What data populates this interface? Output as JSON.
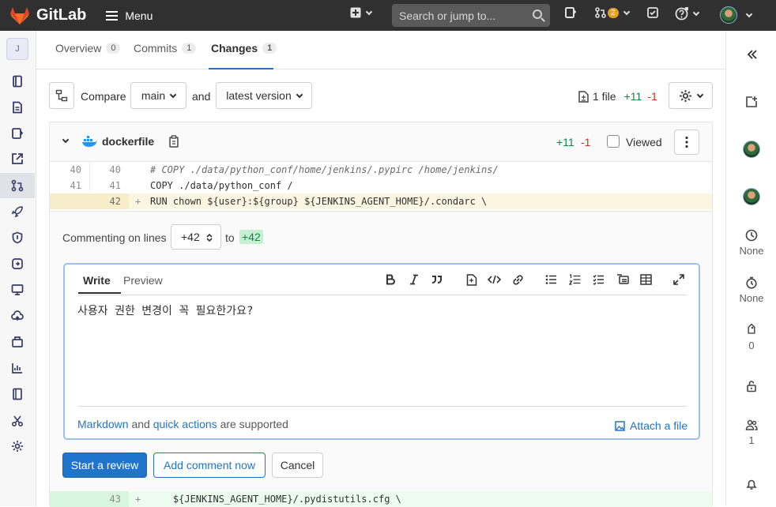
{
  "topbar": {
    "brand": "GitLab",
    "menu_label": "Menu",
    "search_placeholder": "Search or jump to...",
    "mr_count": "2"
  },
  "sidebar": {
    "project_letter": "J"
  },
  "tabs": [
    {
      "label": "Overview",
      "count": "0"
    },
    {
      "label": "Commits",
      "count": "1"
    },
    {
      "label": "Changes",
      "count": "1"
    }
  ],
  "compare": {
    "label": "Compare",
    "base": "main",
    "and_label": "and",
    "target": "latest version",
    "files_label": "1 file",
    "additions": "+11",
    "deletions": "-1"
  },
  "file": {
    "name": "dockerfile",
    "additions": "+11",
    "deletions": "-1",
    "viewed_label": "Viewed"
  },
  "diff_lines": [
    {
      "old": "40",
      "new": "40",
      "sign": "",
      "code": "# COPY ./data/python_conf/home/jenkins/.pypirc /home/jenkins/"
    },
    {
      "old": "41",
      "new": "41",
      "sign": "",
      "code": "COPY ./data/python_conf /"
    },
    {
      "old": "",
      "new": "42",
      "sign": "+",
      "code": "RUN chown ${user}:${group} ${JENKINS_AGENT_HOME}/.condarc \\"
    },
    {
      "old": "",
      "new": "43",
      "sign": "+",
      "code": "    ${JENKINS_AGENT_HOME}/.pydistutils.cfg \\"
    }
  ],
  "comment_form": {
    "lines_label": "Commenting on lines",
    "from_line": "+42",
    "to_label": "to",
    "to_line": "+42",
    "write_tab": "Write",
    "preview_tab": "Preview",
    "body": "사용자 권한 변경이 꼭 필요한가요?",
    "markdown_link": "Markdown",
    "and_text": "and",
    "quick_actions_link": "quick actions",
    "supported_text": "are supported",
    "attach_label": "Attach a file",
    "start_review": "Start a review",
    "add_comment": "Add comment now",
    "cancel": "Cancel"
  },
  "rightsidebar": {
    "milestone": "None",
    "time": "None",
    "labels": "0",
    "participants": "1"
  },
  "colors": {
    "topbar": "#303030",
    "primary": "#1f75cb",
    "added": "#108548",
    "removed": "#dd2b0e"
  }
}
